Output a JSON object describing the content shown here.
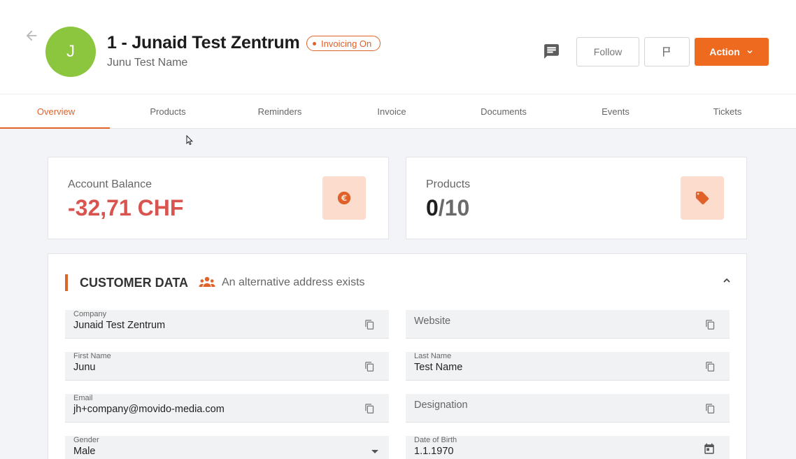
{
  "header": {
    "avatar_letter": "J",
    "title": "1 - Junaid Test Zentrum",
    "badge": "Invoicing On",
    "subtitle": "Junu Test Name",
    "follow_label": "Follow",
    "action_label": "Action",
    "accent_color": "#ed6a1f",
    "avatar_color": "#8cc63f"
  },
  "tabs": [
    {
      "label": "Overview",
      "active": true
    },
    {
      "label": "Products"
    },
    {
      "label": "Reminders"
    },
    {
      "label": "Invoice"
    },
    {
      "label": "Documents"
    },
    {
      "label": "Events"
    },
    {
      "label": "Tickets"
    }
  ],
  "cards": {
    "balance": {
      "label": "Account Balance",
      "value": "-32,71 CHF",
      "icon": "euro-icon"
    },
    "products": {
      "label": "Products",
      "value_used": "0",
      "value_total": "/10",
      "icon": "tag-icon"
    }
  },
  "customer": {
    "heading": "CUSTOMER DATA",
    "alt_address": "An alternative address exists",
    "fields": {
      "company": {
        "label": "Company",
        "value": "Junaid Test Zentrum"
      },
      "website": {
        "placeholder": "Website"
      },
      "first_name": {
        "label": "First Name",
        "value": "Junu"
      },
      "last_name": {
        "label": "Last Name",
        "value": "Test Name"
      },
      "email": {
        "label": "Email",
        "value": "jh+company@movido-media.com"
      },
      "designation": {
        "placeholder": "Designation"
      },
      "gender": {
        "label": "Gender",
        "value": "Male"
      },
      "dob": {
        "label": "Date of Birth",
        "value": "1.1.1970"
      }
    }
  }
}
